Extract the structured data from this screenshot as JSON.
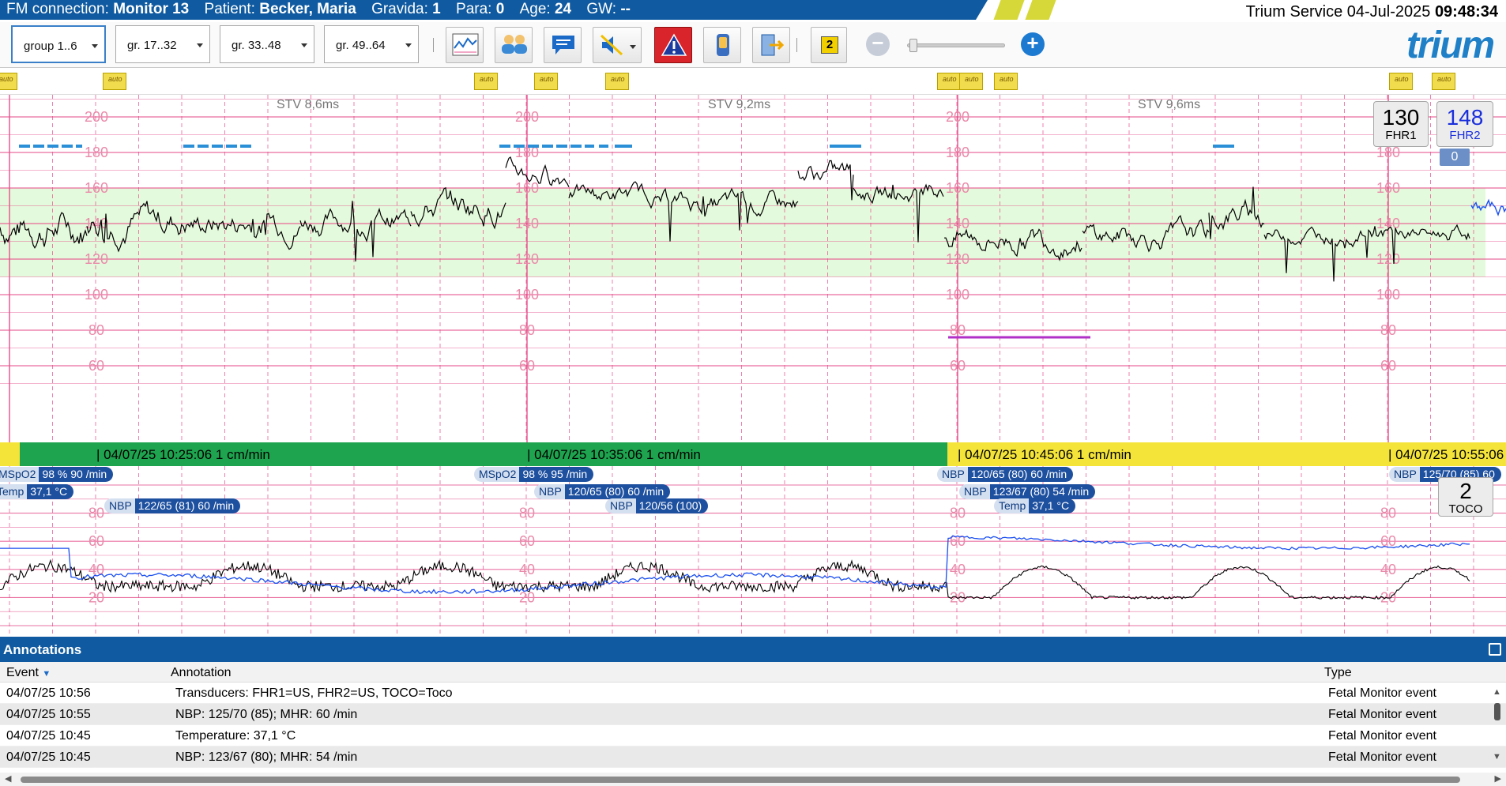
{
  "header": {
    "connection_label": "FM connection:",
    "monitor": "Monitor 13",
    "patient_label": "Patient:",
    "patient_name": "Becker, Maria",
    "gravida_label": "Gravida:",
    "gravida": "1",
    "para_label": "Para:",
    "para": "0",
    "age_label": "Age:",
    "age": "24",
    "gw_label": "GW:",
    "gw": "--",
    "service": "Trium Service",
    "date": "04-Jul-2025",
    "time": "09:48:34"
  },
  "toolbar": {
    "groups": [
      "group 1..6",
      "gr. 17..32",
      "gr. 33..48",
      "gr. 49..64"
    ],
    "page_indicator": "2",
    "zoom_out": "−",
    "zoom_in": "+",
    "logo": "trium",
    "icons": [
      "trend-chart-icon",
      "patients-overview-icon",
      "message-icon",
      "sound-off-icon",
      "alarm-warning-icon",
      "device-icon",
      "exit-icon"
    ]
  },
  "events": {
    "auto_label": "auto"
  },
  "fhr_chart": {
    "stv_labels": [
      "STV 8,6ms",
      "STV 9,2ms",
      "STV 9,6ms"
    ],
    "y_ticks": [
      "200",
      "180",
      "160",
      "140",
      "120",
      "100",
      "80",
      "60"
    ],
    "normal_band": [
      110,
      160
    ],
    "fhr1_value": "130",
    "fhr1_label": "FHR1",
    "fhr2_value": "148",
    "fhr2_label": "FHR2",
    "fhr2_badge": "0",
    "colors": {
      "grid": "#e64f8c",
      "band": "#e4fadc",
      "fhr": "#000000",
      "fhr2": "#1a4ff0",
      "marker": "#2a8fd6",
      "mhr_line": "#b030c8"
    }
  },
  "time_bar": {
    "stamps": [
      "| 04/07/25 10:25:06   1 cm/min",
      "| 04/07/25 10:35:06   1 cm/min",
      "| 04/07/25 10:45:06   1 cm/min",
      "| 04/07/25 10:55:06"
    ]
  },
  "toco_chart": {
    "y_ticks": [
      "80",
      "60",
      "40",
      "20"
    ],
    "toco_value": "2",
    "toco_label": "TOCO",
    "vitals": [
      {
        "k": "MSpO2",
        "v": "98 % 90 /min"
      },
      {
        "k": "Temp",
        "v": "37,1 °C"
      },
      {
        "k": "NBP",
        "v": "122/65 (81) 60 /min"
      },
      {
        "k": "MSpO2",
        "v": "98 % 95 /min"
      },
      {
        "k": "NBP",
        "v": "120/65 (80) 60 /min"
      },
      {
        "k": "NBP",
        "v": "120/56 (100)"
      },
      {
        "k": "NBP",
        "v": "120/65 (80) 60 /min"
      },
      {
        "k": "NBP",
        "v": "123/67 (80) 54 /min"
      },
      {
        "k": "Temp",
        "v": "37,1 °C"
      },
      {
        "k": "NBP",
        "v": "125/70 (85) 60"
      }
    ]
  },
  "annotations": {
    "title": "Annotations",
    "columns": {
      "event": "Event",
      "annotation": "Annotation",
      "type": "Type"
    },
    "rows": [
      {
        "event": "04/07/25 10:56",
        "annotation": "Transducers: FHR1=US, FHR2=US, TOCO=Toco",
        "type": "Fetal Monitor event"
      },
      {
        "event": "04/07/25 10:55",
        "annotation": "NBP: 125/70 (85); MHR: 60 /min",
        "type": "Fetal Monitor event"
      },
      {
        "event": "04/07/25 10:45",
        "annotation": "Temperature: 37,1 °C",
        "type": "Fetal Monitor event"
      },
      {
        "event": "04/07/25 10:45",
        "annotation": "NBP: 123/67 (80); MHR: 54 /min",
        "type": "Fetal Monitor event"
      }
    ]
  }
}
